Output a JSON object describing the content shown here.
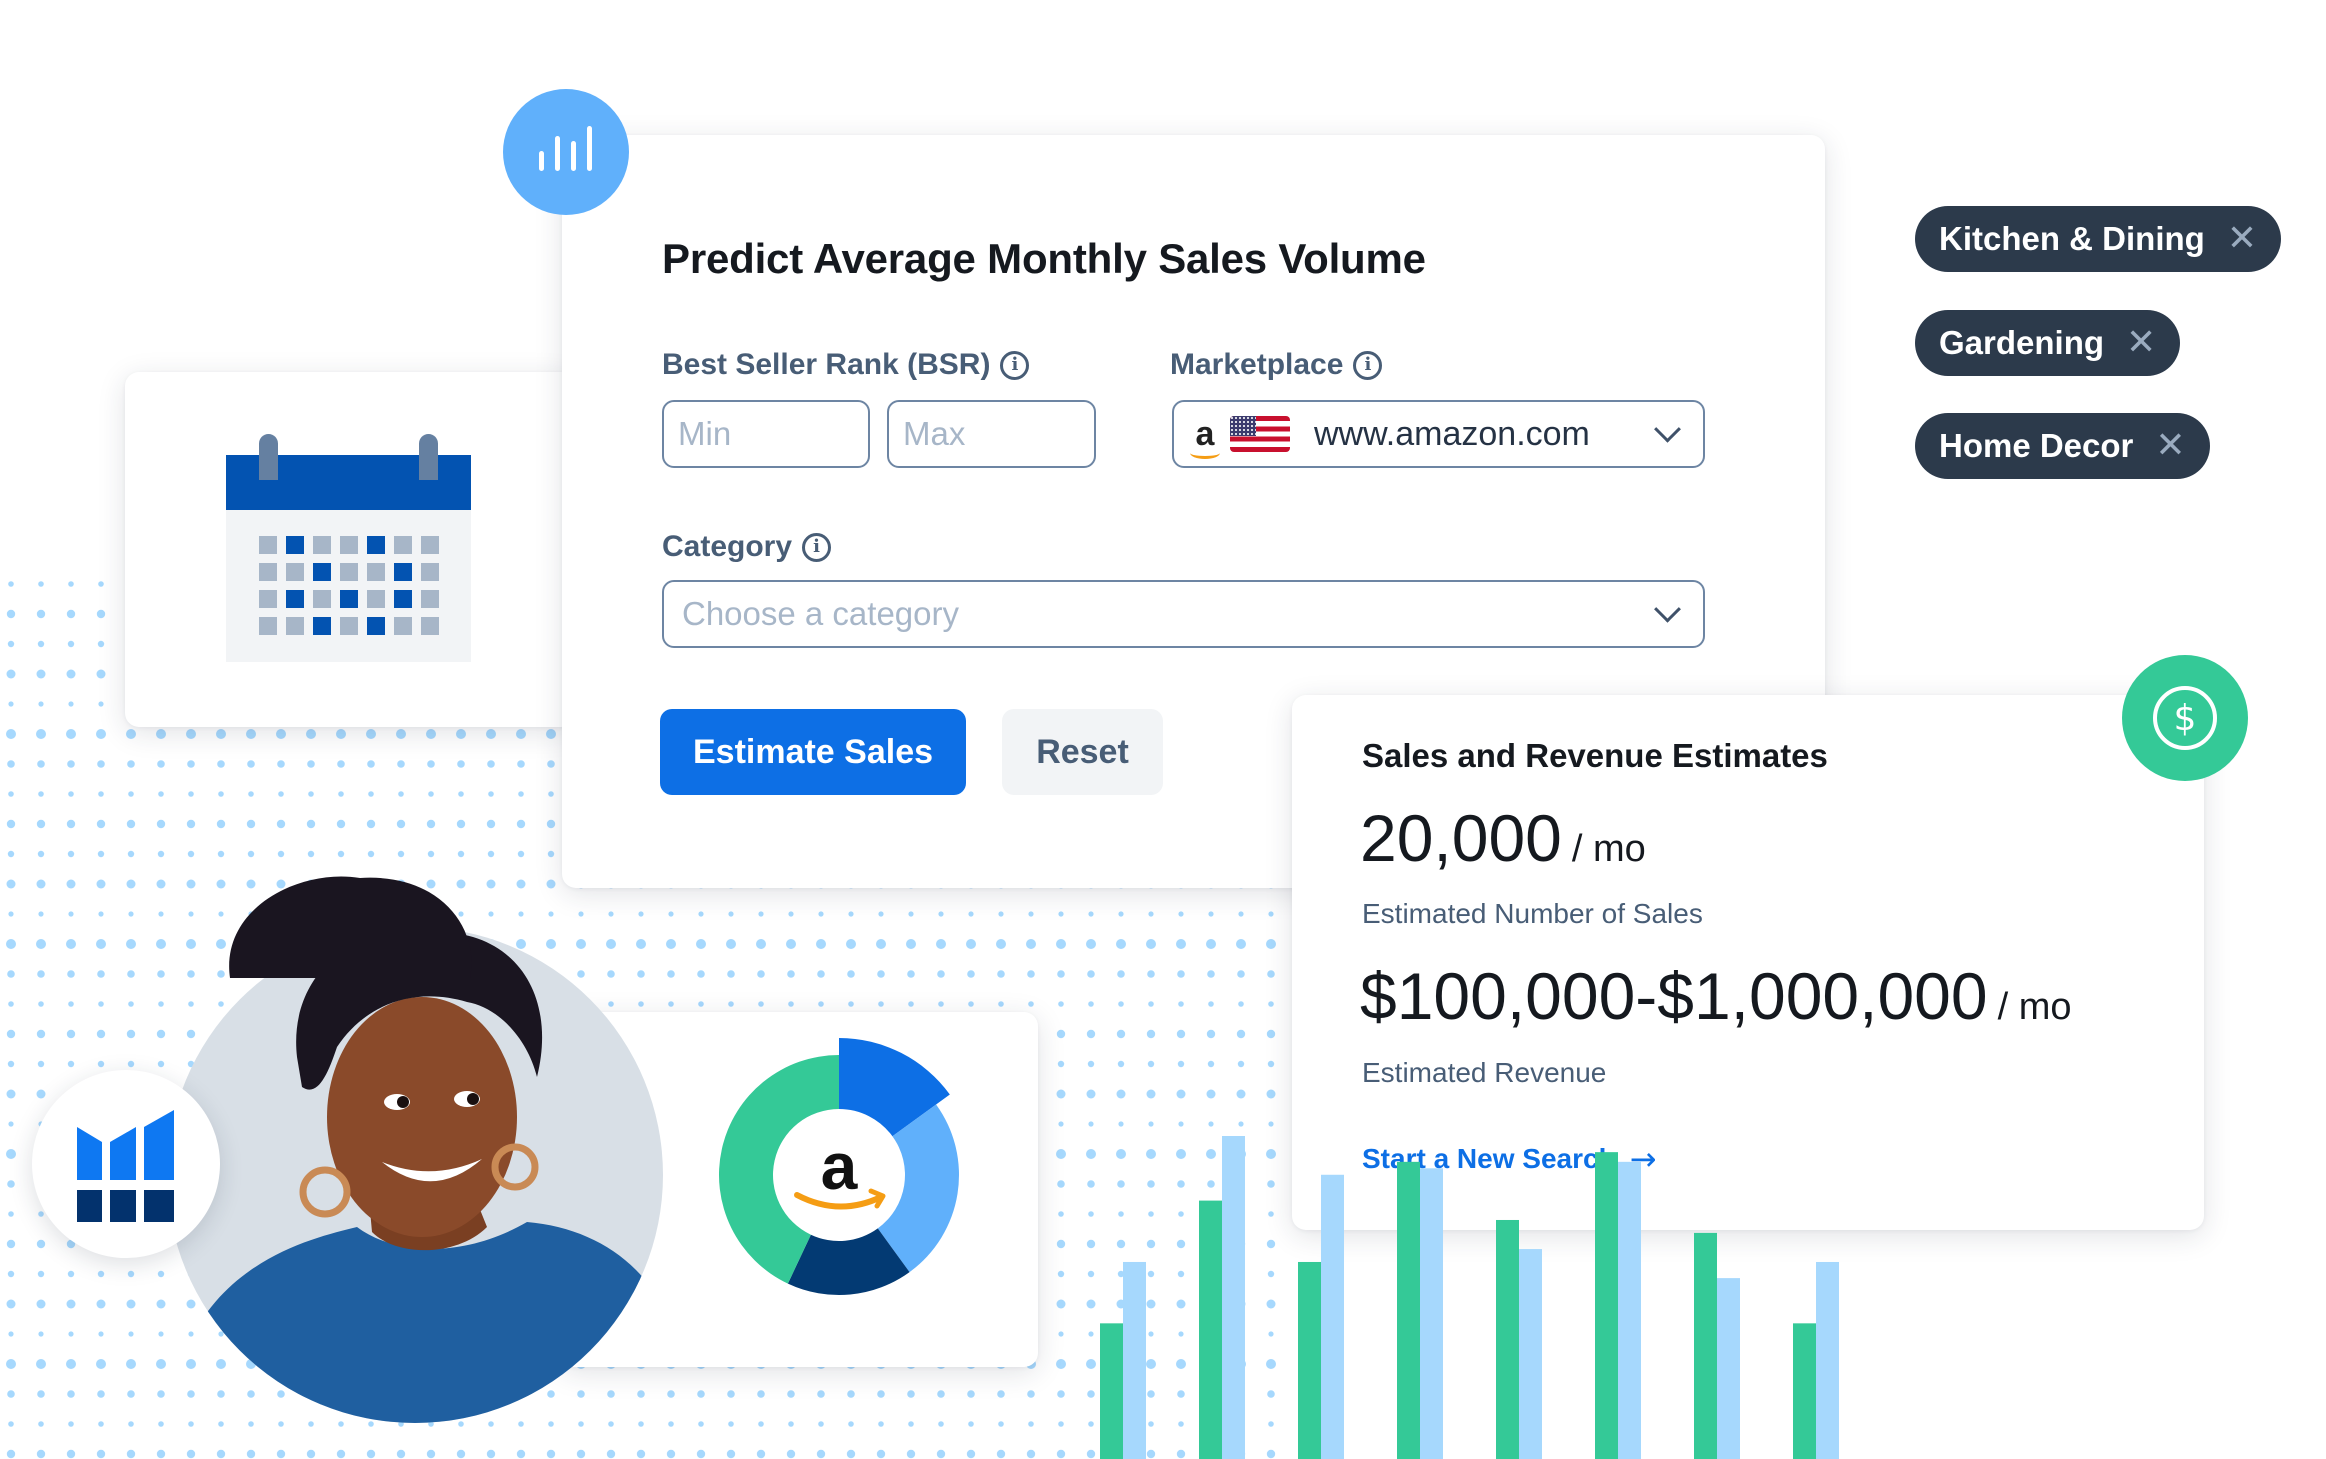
{
  "form": {
    "title": "Predict Average Monthly Sales Volume",
    "bsr_label": "Best Seller Rank (BSR)",
    "bsr_min_placeholder": "Min",
    "bsr_max_placeholder": "Max",
    "marketplace_label": "Marketplace",
    "marketplace_value": "www.amazon.com",
    "category_label": "Category",
    "category_placeholder": "Choose a category",
    "estimate_button": "Estimate Sales",
    "reset_button": "Reset",
    "info_glyph": "i"
  },
  "tags": [
    {
      "label": "Kitchen & Dining"
    },
    {
      "label": "Gardening"
    },
    {
      "label": "Home Decor"
    }
  ],
  "tag_remove_glyph": "✕",
  "results": {
    "title": "Sales and Revenue Estimates",
    "sales_value": "20,000",
    "sales_unit": "/ mo",
    "sales_caption": "Estimated Number of Sales",
    "revenue_value": "$100,000-$1,000,000",
    "revenue_unit": "/ mo",
    "revenue_caption": "Estimated Revenue",
    "new_search_link": "Start a New Search",
    "arrow_glyph": "→"
  },
  "badges": {
    "dollar_glyph": "$"
  },
  "calendar": {
    "rows": [
      [
        0,
        1,
        0,
        0,
        1,
        0,
        0
      ],
      [
        0,
        0,
        1,
        0,
        0,
        1,
        0
      ],
      [
        0,
        1,
        0,
        1,
        0,
        1,
        0
      ],
      [
        0,
        0,
        1,
        0,
        1,
        0,
        0
      ]
    ]
  },
  "colors": {
    "primary": "#0d6fe5",
    "navy": "#033a73",
    "light_blue": "#60b0fb",
    "green": "#34c997",
    "pale_blue": "#a6d8fd",
    "tag_bg": "#2c3a4b"
  },
  "chart_data": [
    {
      "type": "pie",
      "title": "",
      "center_label": "amazon-logo",
      "slices": [
        {
          "name": "segment-1",
          "value": 15,
          "color": "#0d6fe5",
          "exploded": true
        },
        {
          "name": "segment-2",
          "value": 25,
          "color": "#60b0fb"
        },
        {
          "name": "segment-3",
          "value": 17,
          "color": "#033a73"
        },
        {
          "name": "segment-4",
          "value": 43,
          "color": "#34c997"
        }
      ]
    },
    {
      "type": "bar",
      "title": "",
      "categories": [
        "1",
        "2",
        "3",
        "4",
        "5",
        "6",
        "7",
        "8"
      ],
      "series": [
        {
          "name": "green",
          "color": "#34c997",
          "values": [
            42,
            80,
            61,
            92,
            74,
            95,
            70,
            42
          ]
        },
        {
          "name": "light-blue",
          "color": "#a6d8fd",
          "values": [
            61,
            100,
            88,
            90,
            65,
            92,
            56,
            61
          ]
        }
      ],
      "ylim": [
        0,
        100
      ],
      "grid": false,
      "legend": "none"
    }
  ]
}
